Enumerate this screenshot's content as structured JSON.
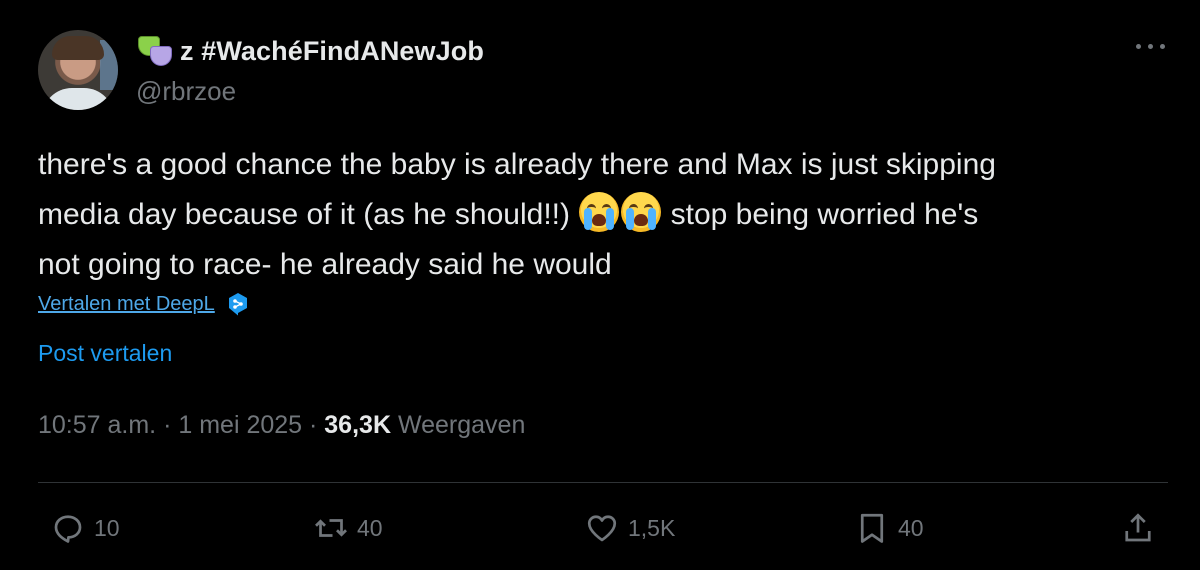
{
  "author": {
    "display_name": "z #WachéFindANewJob",
    "handle": "@rbrzoe",
    "name_emoji_icon": "performing-arts-icon"
  },
  "tweet": {
    "text_line1": "there's a good chance the baby is already there and Max is just skipping",
    "text_line2_before": "media day because of it (as he should!!) ",
    "text_line2_after": " stop being worried he's",
    "text_line3": "not going to race- he already said he would",
    "emoji_icon": "loudly-crying-face-icon"
  },
  "translate": {
    "deepl_label": "Vertalen met DeepL",
    "post_translate_label": "Post vertalen"
  },
  "meta": {
    "time": "10:57 a.m.",
    "separator": " · ",
    "date": "1 mei 2025",
    "views_count": "36,3K",
    "views_label": "Weergaven"
  },
  "actions": {
    "replies": "10",
    "reposts": "40",
    "likes": "1,5K",
    "bookmarks": "40"
  },
  "colors": {
    "background": "#000000",
    "text": "#e7e9ea",
    "secondary": "#71767b",
    "link": "#1d9bf0",
    "divider": "#2f3336"
  }
}
